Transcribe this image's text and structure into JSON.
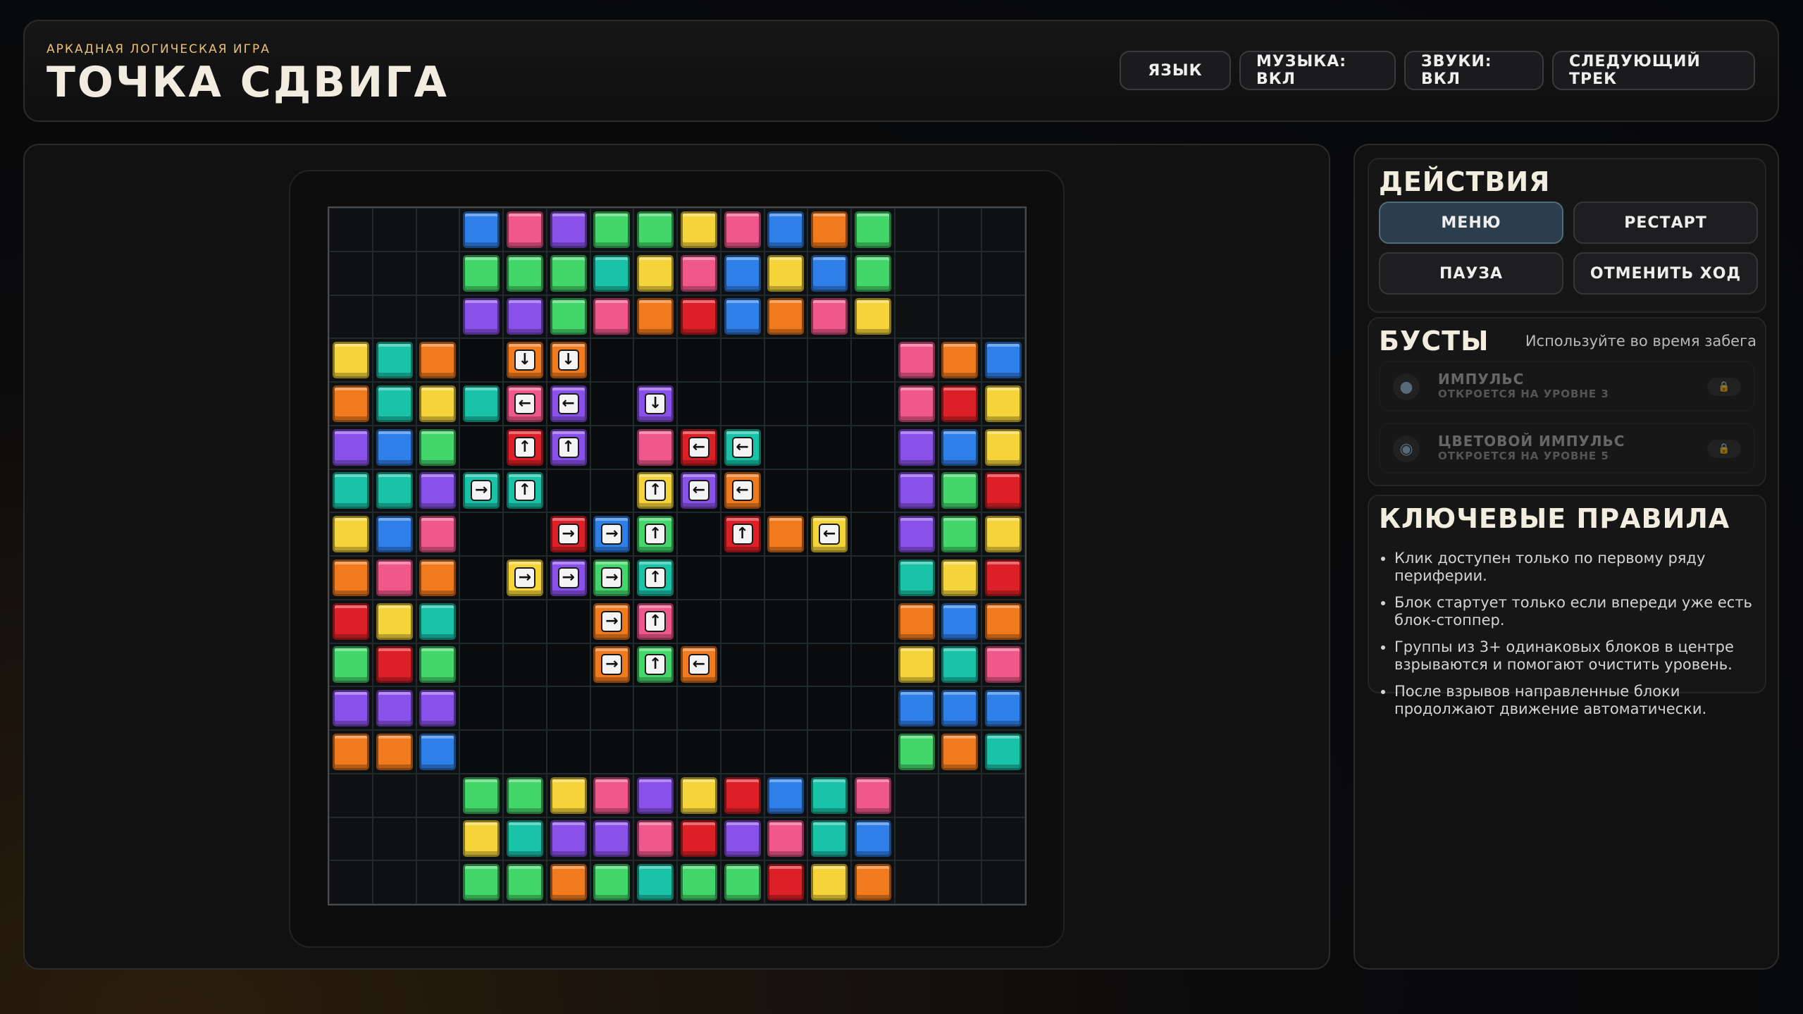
{
  "header": {
    "subtitle": "АРКАДНАЯ ЛОГИЧЕСКАЯ ИГРА",
    "title": "ТОЧКА СДВИГА",
    "buttons": [
      "ЯЗЫК",
      "МУЗЫКА: ВКЛ",
      "ЗВУКИ: ВКЛ",
      "СЛЕДУЮЩИЙ ТРЕК"
    ]
  },
  "actions": {
    "title": "ДЕЙСТВИЯ",
    "menu": "МЕНЮ",
    "restart": "РЕСТАРТ",
    "pause": "ПАУЗА",
    "undo": "ОТМЕНИТЬ ХОД"
  },
  "boosts": {
    "title": "БУСТЫ",
    "hint": "Используйте во время забега",
    "items": [
      {
        "name": "ИМПУЛЬС",
        "sub": "ОТКРОЕТСЯ НА УРОВНЕ 3",
        "icon": "planet-icon"
      },
      {
        "name": "ЦВЕТОВОЙ ИМПУЛЬС",
        "sub": "ОТКРОЕТСЯ НА УРОВНЕ 5",
        "icon": "ringed-planet-icon"
      }
    ]
  },
  "rules": {
    "title": "КЛЮЧЕВЫЕ ПРАВИЛА",
    "items": [
      "Клик доступен только по первому ряду периферии.",
      "Блок стартует только если впереди уже есть блок-стоппер.",
      "Группы из 3+ одинаковых блоков в центре взрываются и помогают очистить уровень.",
      "После взрывов направленные блоки продолжают движение автоматически."
    ]
  },
  "board": {
    "size": 16,
    "colors": {
      "B": "#2f7fe8",
      "P": "#f0578a",
      "V": "#8a50ea",
      "G": "#43d66a",
      "Y": "#f5d43a",
      "O": "#f07a1c",
      "R": "#dd2027",
      "T": "#18c3a8"
    },
    "rows": [
      "...BPVGGYPBOG...",
      "...GGGTYPBYBG...",
      "...VVGPORBOPY...",
      "YTO.OO....PPOB",
      "OTYTPV.V....PRY",
      "VBG.RV.PRT..VBY",
      "TTVTT.YVO...VGR",
      "YBP..RBG.RO.YVGY",
      "OPO.YVGT....TYR",
      "RYT...OP....OBO",
      "GRG...OGO...YTP",
      "VVV.........BBB",
      "OOB.........GOT",
      "...GGYPVYRBTP...",
      "...YTVVPRVPTB...",
      "...GGOGTGGRYO..."
    ],
    "cells": [
      [
        3,
        0,
        "B",
        ""
      ],
      [
        4,
        0,
        "P",
        ""
      ],
      [
        5,
        0,
        "V",
        ""
      ],
      [
        6,
        0,
        "G",
        ""
      ],
      [
        7,
        0,
        "G",
        ""
      ],
      [
        8,
        0,
        "Y",
        ""
      ],
      [
        9,
        0,
        "P",
        ""
      ],
      [
        10,
        0,
        "B",
        ""
      ],
      [
        11,
        0,
        "O",
        ""
      ],
      [
        12,
        0,
        "G",
        ""
      ],
      [
        3,
        1,
        "G",
        ""
      ],
      [
        4,
        1,
        "G",
        ""
      ],
      [
        5,
        1,
        "G",
        ""
      ],
      [
        6,
        1,
        "T",
        ""
      ],
      [
        7,
        1,
        "Y",
        ""
      ],
      [
        8,
        1,
        "P",
        ""
      ],
      [
        9,
        1,
        "B",
        ""
      ],
      [
        10,
        1,
        "Y",
        ""
      ],
      [
        11,
        1,
        "B",
        ""
      ],
      [
        12,
        1,
        "G",
        ""
      ],
      [
        3,
        2,
        "V",
        ""
      ],
      [
        4,
        2,
        "V",
        ""
      ],
      [
        5,
        2,
        "G",
        ""
      ],
      [
        6,
        2,
        "P",
        ""
      ],
      [
        7,
        2,
        "O",
        ""
      ],
      [
        8,
        2,
        "R",
        ""
      ],
      [
        9,
        2,
        "B",
        ""
      ],
      [
        10,
        2,
        "O",
        ""
      ],
      [
        11,
        2,
        "P",
        ""
      ],
      [
        12,
        2,
        "Y",
        ""
      ],
      [
        0,
        3,
        "Y",
        ""
      ],
      [
        1,
        3,
        "T",
        ""
      ],
      [
        2,
        3,
        "O",
        ""
      ],
      [
        4,
        3,
        "O",
        "↓"
      ],
      [
        5,
        3,
        "O",
        "↓"
      ],
      [
        13,
        3,
        "P",
        ""
      ],
      [
        14,
        3,
        "O",
        ""
      ],
      [
        15,
        3,
        "B",
        ""
      ],
      [
        0,
        4,
        "O",
        ""
      ],
      [
        1,
        4,
        "T",
        ""
      ],
      [
        2,
        4,
        "Y",
        ""
      ],
      [
        3,
        4,
        "T",
        ""
      ],
      [
        4,
        4,
        "P",
        "←"
      ],
      [
        5,
        4,
        "V",
        "←"
      ],
      [
        7,
        4,
        "V",
        "↓"
      ],
      [
        13,
        4,
        "P",
        ""
      ],
      [
        14,
        4,
        "R",
        ""
      ],
      [
        15,
        4,
        "Y",
        ""
      ],
      [
        0,
        5,
        "V",
        ""
      ],
      [
        1,
        5,
        "B",
        ""
      ],
      [
        2,
        5,
        "G",
        ""
      ],
      [
        4,
        5,
        "R",
        "↑"
      ],
      [
        5,
        5,
        "V",
        "↑"
      ],
      [
        7,
        5,
        "P",
        ""
      ],
      [
        8,
        5,
        "R",
        "←"
      ],
      [
        9,
        5,
        "T",
        "←"
      ],
      [
        13,
        5,
        "V",
        ""
      ],
      [
        14,
        5,
        "B",
        ""
      ],
      [
        15,
        5,
        "Y",
        ""
      ],
      [
        0,
        6,
        "T",
        ""
      ],
      [
        1,
        6,
        "T",
        ""
      ],
      [
        2,
        6,
        "V",
        ""
      ],
      [
        3,
        6,
        "T",
        "→"
      ],
      [
        4,
        6,
        "T",
        "↑"
      ],
      [
        7,
        6,
        "Y",
        "↑"
      ],
      [
        8,
        6,
        "V",
        "←"
      ],
      [
        9,
        6,
        "O",
        "←"
      ],
      [
        13,
        6,
        "V",
        ""
      ],
      [
        14,
        6,
        "G",
        ""
      ],
      [
        15,
        6,
        "R",
        ""
      ],
      [
        0,
        7,
        "Y",
        ""
      ],
      [
        1,
        7,
        "B",
        ""
      ],
      [
        2,
        7,
        "P",
        ""
      ],
      [
        5,
        7,
        "R",
        "→"
      ],
      [
        6,
        7,
        "B",
        "→"
      ],
      [
        7,
        7,
        "G",
        "↑"
      ],
      [
        9,
        7,
        "R",
        "↑"
      ],
      [
        10,
        7,
        "O",
        ""
      ],
      [
        11,
        7,
        "Y",
        "←"
      ],
      [
        13,
        7,
        "V",
        ""
      ],
      [
        14,
        7,
        "G",
        ""
      ],
      [
        15,
        7,
        "Y",
        ""
      ],
      [
        0,
        8,
        "O",
        ""
      ],
      [
        1,
        8,
        "P",
        ""
      ],
      [
        2,
        8,
        "O",
        ""
      ],
      [
        4,
        8,
        "Y",
        "→"
      ],
      [
        5,
        8,
        "V",
        "→"
      ],
      [
        6,
        8,
        "G",
        "→"
      ],
      [
        7,
        8,
        "T",
        "↑"
      ],
      [
        13,
        8,
        "T",
        ""
      ],
      [
        14,
        8,
        "Y",
        ""
      ],
      [
        15,
        8,
        "R",
        ""
      ],
      [
        0,
        9,
        "R",
        ""
      ],
      [
        1,
        9,
        "Y",
        ""
      ],
      [
        2,
        9,
        "T",
        ""
      ],
      [
        6,
        9,
        "O",
        "→"
      ],
      [
        7,
        9,
        "P",
        "↑"
      ],
      [
        13,
        9,
        "O",
        ""
      ],
      [
        14,
        9,
        "B",
        ""
      ],
      [
        15,
        9,
        "O",
        ""
      ],
      [
        0,
        10,
        "G",
        ""
      ],
      [
        1,
        10,
        "R",
        ""
      ],
      [
        2,
        10,
        "G",
        ""
      ],
      [
        6,
        10,
        "O",
        "→"
      ],
      [
        7,
        10,
        "G",
        "↑"
      ],
      [
        8,
        10,
        "O",
        "←"
      ],
      [
        13,
        10,
        "Y",
        ""
      ],
      [
        14,
        10,
        "T",
        ""
      ],
      [
        15,
        10,
        "P",
        ""
      ],
      [
        0,
        11,
        "V",
        ""
      ],
      [
        1,
        11,
        "V",
        ""
      ],
      [
        2,
        11,
        "V",
        ""
      ],
      [
        13,
        11,
        "B",
        ""
      ],
      [
        14,
        11,
        "B",
        ""
      ],
      [
        15,
        11,
        "B",
        ""
      ],
      [
        0,
        12,
        "O",
        ""
      ],
      [
        1,
        12,
        "O",
        ""
      ],
      [
        2,
        12,
        "B",
        ""
      ],
      [
        13,
        12,
        "G",
        ""
      ],
      [
        14,
        12,
        "O",
        ""
      ],
      [
        15,
        12,
        "T",
        ""
      ],
      [
        3,
        13,
        "G",
        ""
      ],
      [
        4,
        13,
        "G",
        ""
      ],
      [
        5,
        13,
        "Y",
        ""
      ],
      [
        6,
        13,
        "P",
        ""
      ],
      [
        7,
        13,
        "V",
        ""
      ],
      [
        8,
        13,
        "Y",
        ""
      ],
      [
        9,
        13,
        "R",
        ""
      ],
      [
        10,
        13,
        "B",
        ""
      ],
      [
        11,
        13,
        "T",
        ""
      ],
      [
        12,
        13,
        "P",
        ""
      ],
      [
        3,
        14,
        "Y",
        ""
      ],
      [
        4,
        14,
        "T",
        ""
      ],
      [
        5,
        14,
        "V",
        ""
      ],
      [
        6,
        14,
        "V",
        ""
      ],
      [
        7,
        14,
        "P",
        ""
      ],
      [
        8,
        14,
        "R",
        ""
      ],
      [
        9,
        14,
        "V",
        ""
      ],
      [
        10,
        14,
        "P",
        ""
      ],
      [
        11,
        14,
        "T",
        ""
      ],
      [
        12,
        14,
        "B",
        ""
      ],
      [
        3,
        15,
        "G",
        ""
      ],
      [
        4,
        15,
        "G",
        ""
      ],
      [
        5,
        15,
        "O",
        ""
      ],
      [
        6,
        15,
        "G",
        ""
      ],
      [
        7,
        15,
        "T",
        ""
      ],
      [
        8,
        15,
        "G",
        ""
      ],
      [
        9,
        15,
        "G",
        ""
      ],
      [
        10,
        15,
        "R",
        ""
      ],
      [
        11,
        15,
        "Y",
        ""
      ],
      [
        12,
        15,
        "O",
        ""
      ]
    ]
  }
}
